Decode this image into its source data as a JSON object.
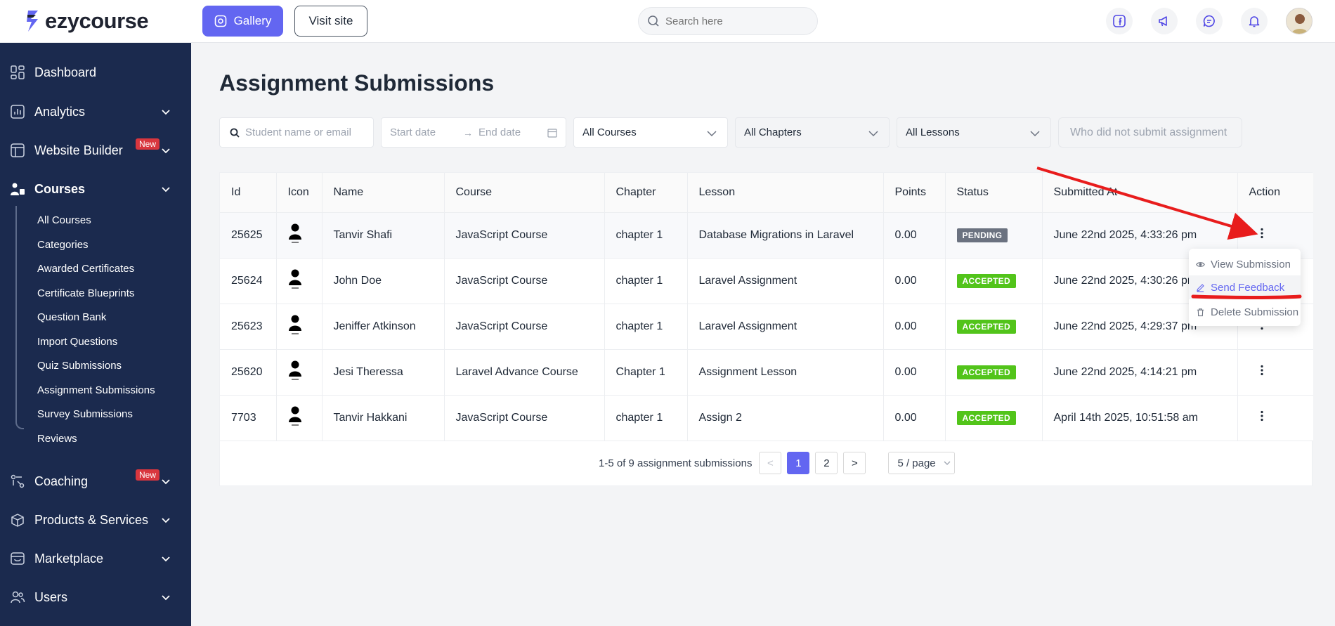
{
  "brand": {
    "name": "ezycourse",
    "accent": "#6366f1",
    "sidebar_bg": "#1b2a4e"
  },
  "topbar": {
    "gallery_label": "Gallery",
    "visit_label": "Visit site",
    "search_placeholder": "Search here",
    "icons": [
      "facebook-icon",
      "megaphone-icon",
      "chat-icon",
      "bell-icon"
    ]
  },
  "sidebar": {
    "items": [
      {
        "label": "Dashboard",
        "icon": "dashboard-icon"
      },
      {
        "label": "Analytics",
        "icon": "analytics-icon"
      },
      {
        "label": "Website Builder",
        "icon": "website-builder-icon",
        "badge": "New"
      },
      {
        "label": "Courses",
        "icon": "courses-icon",
        "active": true
      },
      {
        "label": "Coaching",
        "icon": "coaching-icon",
        "badge": "New"
      },
      {
        "label": "Products & Services",
        "icon": "products-icon"
      },
      {
        "label": "Marketplace",
        "icon": "marketplace-icon"
      },
      {
        "label": "Users",
        "icon": "users-icon"
      }
    ],
    "course_subitems": [
      "All Courses",
      "Categories",
      "Awarded Certificates",
      "Certificate Blueprints",
      "Question Bank",
      "Import Questions",
      "Quiz Submissions",
      "Assignment Submissions",
      "Survey Submissions",
      "Reviews"
    ]
  },
  "main": {
    "title": "Assignment Submissions",
    "filters": {
      "student_placeholder": "Student name or email",
      "start_placeholder": "Start date",
      "end_placeholder": "End date",
      "course": "All Courses",
      "chapter": "All Chapters",
      "lesson": "All Lessons",
      "not_submitted_label": "Who did not submit assignment"
    },
    "table": {
      "columns": [
        "Id",
        "Icon",
        "Name",
        "Course",
        "Chapter",
        "Lesson",
        "Points",
        "Status",
        "Submitted At",
        "Action"
      ],
      "rows": [
        {
          "id": "25625",
          "name": "Tanvir Shafi",
          "course": "JavaScript Course",
          "chapter": "chapter 1",
          "lesson": "Database Migrations in Laravel",
          "points": "0.00",
          "status": "PENDING",
          "submitted": "June 22nd 2025, 4:33:26 pm"
        },
        {
          "id": "25624",
          "name": "John Doe",
          "course": "JavaScript Course",
          "chapter": "chapter 1",
          "lesson": "Laravel Assignment",
          "points": "0.00",
          "status": "ACCEPTED",
          "submitted": "June 22nd 2025, 4:30:26 pm"
        },
        {
          "id": "25623",
          "name": "Jeniffer Atkinson",
          "course": "JavaScript Course",
          "chapter": "chapter 1",
          "lesson": "Laravel Assignment",
          "points": "0.00",
          "status": "ACCEPTED",
          "submitted": "June 22nd 2025, 4:29:37 pm"
        },
        {
          "id": "25620",
          "name": "Jesi Theressa",
          "course": "Laravel Advance Course",
          "chapter": "Chapter 1",
          "lesson": "Assignment Lesson",
          "points": "0.00",
          "status": "ACCEPTED",
          "submitted": "June 22nd 2025, 4:14:21 pm"
        },
        {
          "id": "7703",
          "name": "Tanvir Hakkani",
          "course": "JavaScript Course",
          "chapter": "chapter 1",
          "lesson": "Assign 2",
          "points": "0.00",
          "status": "ACCEPTED",
          "submitted": "April 14th 2025, 10:51:58 am"
        }
      ]
    },
    "pagination": {
      "summary": "1-5 of 9 assignment submissions",
      "prev": "<",
      "pages": [
        "1",
        "2"
      ],
      "current": "1",
      "next": ">",
      "page_size": "5 / page"
    },
    "action_menu": {
      "items": [
        {
          "label": "View Submission",
          "icon": "eye-icon"
        },
        {
          "label": "Send Feedback",
          "icon": "edit-icon",
          "highlighted": true
        },
        {
          "label": "Delete Submission",
          "icon": "trash-icon"
        }
      ]
    }
  },
  "annotation_color": "#e81c1c"
}
